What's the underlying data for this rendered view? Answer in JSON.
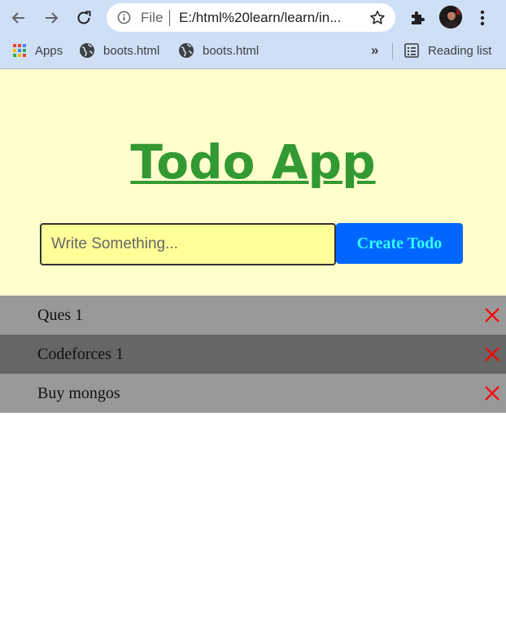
{
  "browser": {
    "omnibox": {
      "scheme_label": "File",
      "url": "E:/html%20learn/learn/in..."
    },
    "bookmarks": [
      {
        "label": "Apps",
        "icon": "apps-grid-icon"
      },
      {
        "label": "boots.html",
        "icon": "globe-icon"
      },
      {
        "label": "boots.html",
        "icon": "globe-icon"
      }
    ],
    "bookmarks_more": "»",
    "reading_list": {
      "label": "Reading list",
      "icon": "reading-list-icon"
    }
  },
  "page": {
    "title": "Todo App",
    "title_color": "#339933",
    "background": "#ffffcc",
    "input": {
      "value": "",
      "placeholder": "Write Something..."
    },
    "create_button": {
      "label": "Create Todo",
      "bg": "#0066ff",
      "fg": "#33ffff"
    },
    "todos": [
      {
        "text": "Ques 1"
      },
      {
        "text": "Codeforces 1"
      },
      {
        "text": "Buy mongos"
      }
    ],
    "delete_icon": "close-x-icon",
    "delete_color": "#ff0000"
  }
}
